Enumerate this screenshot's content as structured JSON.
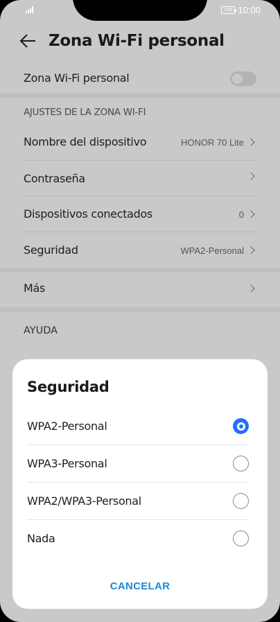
{
  "status_bar": {
    "battery": "100",
    "time": "10:00"
  },
  "header": {
    "title": "Zona Wi-Fi personal"
  },
  "hotspot": {
    "label": "Zona Wi-Fi personal",
    "enabled": false
  },
  "settings": {
    "section_title": "AJUSTES DE LA ZONA WI-FI",
    "rows": [
      {
        "label": "Nombre del dispositivo",
        "value": "HONOR 70 Lite"
      },
      {
        "label": "Contraseña",
        "value": ""
      },
      {
        "label": "Dispositivos conectados",
        "value": "0"
      },
      {
        "label": "Seguridad",
        "value": "WPA2-Personal"
      }
    ],
    "more": {
      "label": "Más"
    },
    "help": "AYUDA"
  },
  "dialog": {
    "title": "Seguridad",
    "options": [
      {
        "label": "WPA2-Personal",
        "selected": true
      },
      {
        "label": "WPA3-Personal",
        "selected": false
      },
      {
        "label": "WPA2/WPA3-Personal",
        "selected": false
      },
      {
        "label": "Nada",
        "selected": false
      }
    ],
    "cancel_label": "CANCELAR"
  },
  "colors": {
    "accent": "#256fff",
    "cancel_text": "#1a8bd3",
    "dim_background": "#c9c9c9"
  }
}
